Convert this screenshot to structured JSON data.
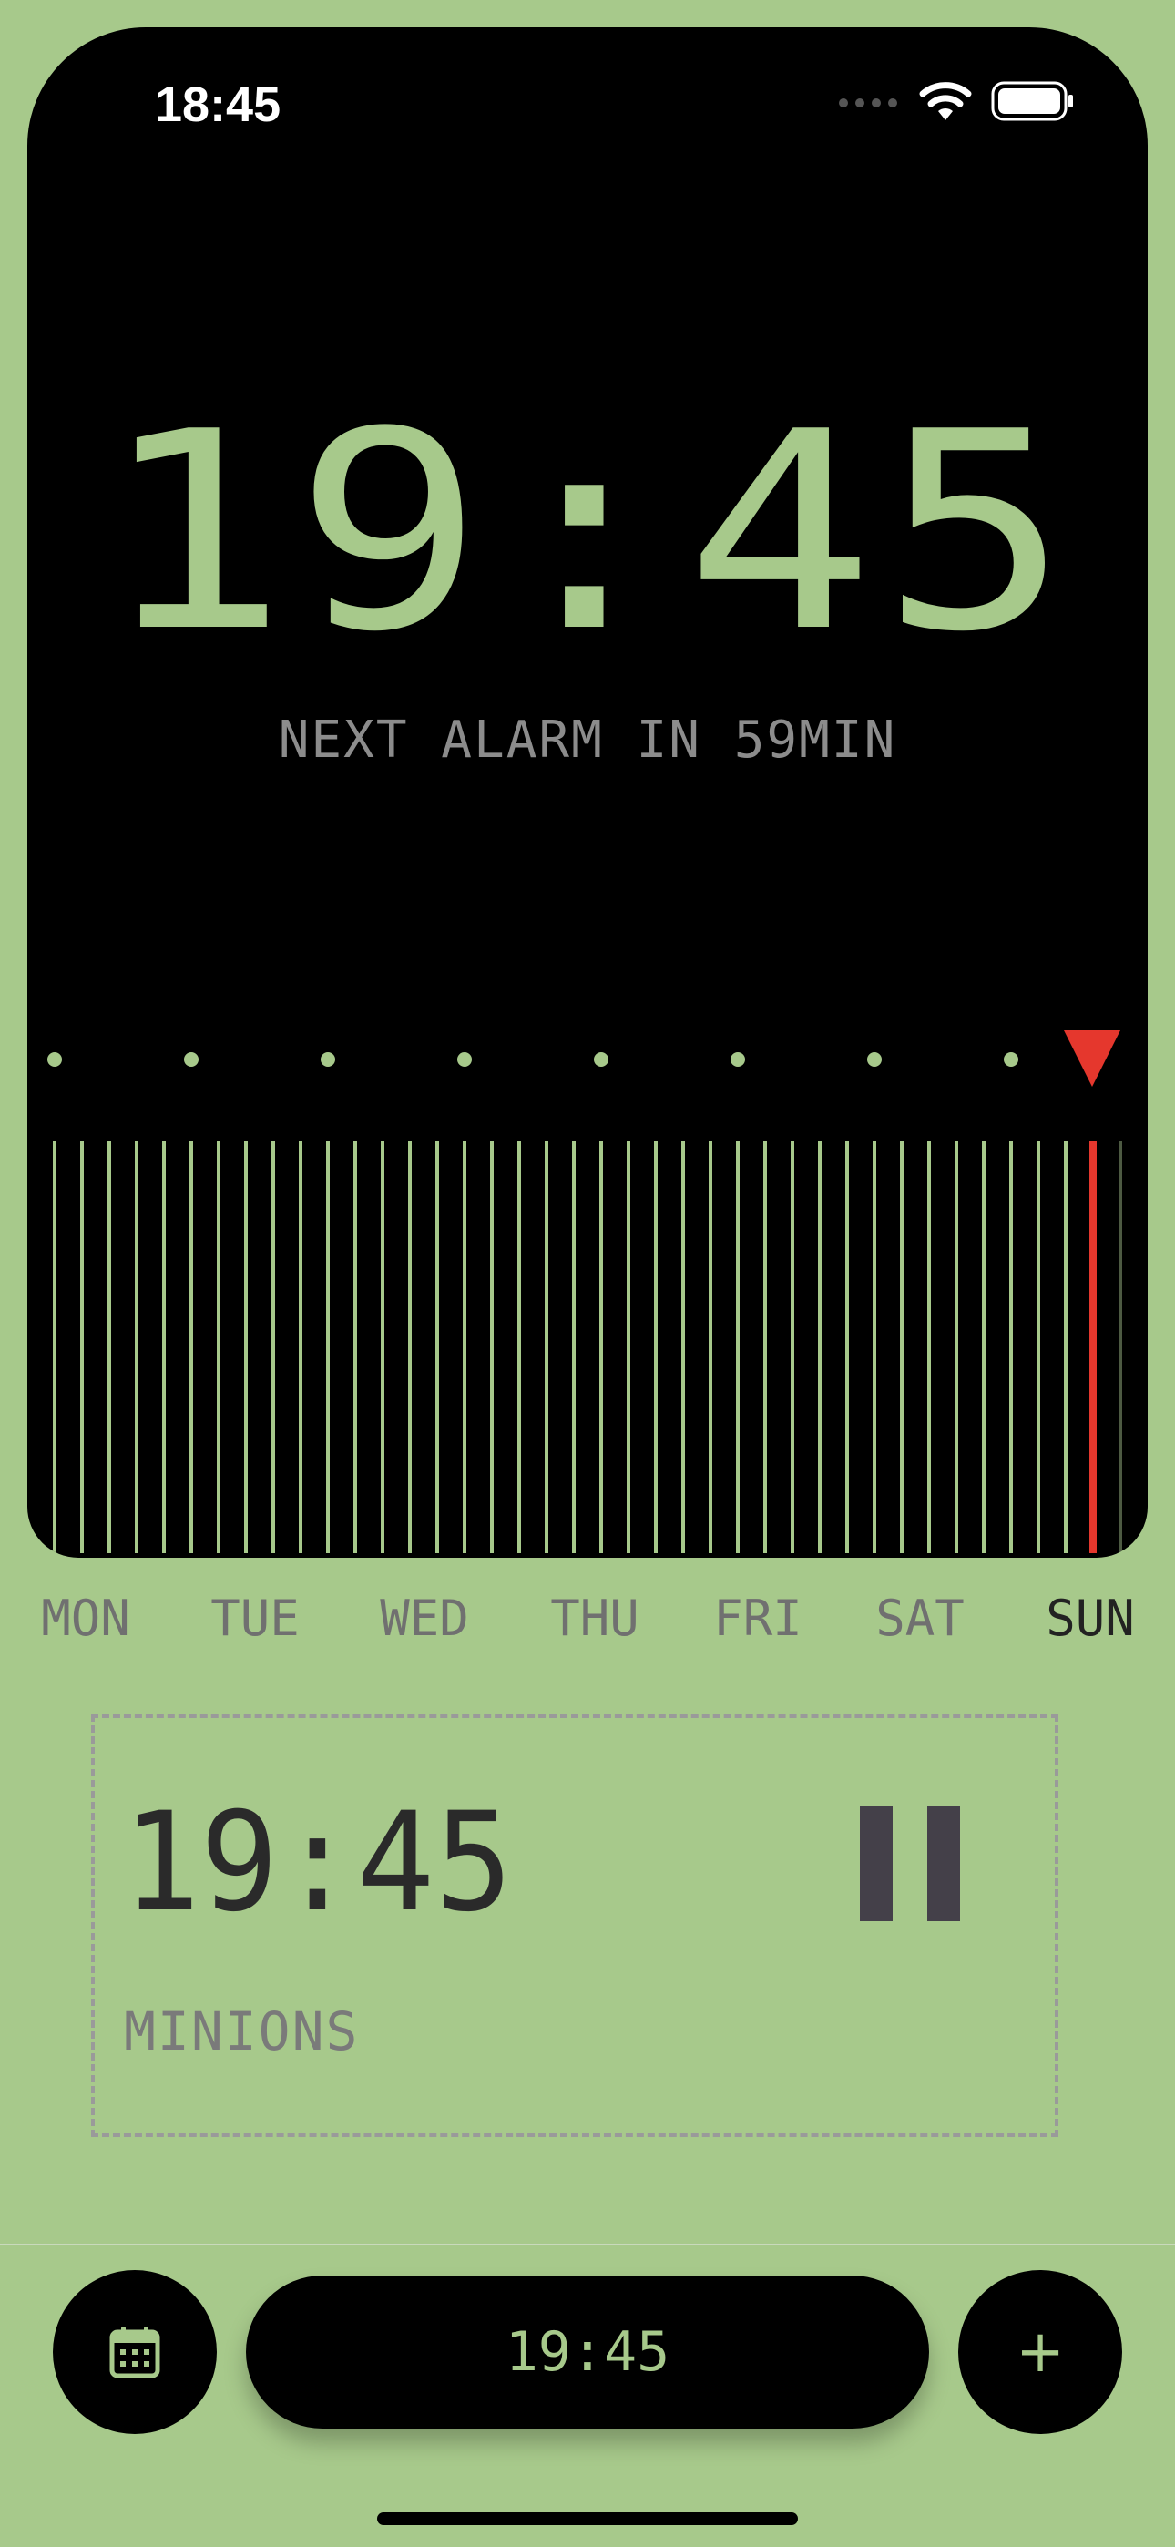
{
  "status_bar": {
    "time": "18:45"
  },
  "clock": {
    "time": "19:45",
    "next_alarm": "NEXT ALARM IN 59MIN"
  },
  "timeline": {
    "accent_color": "#a7c98b",
    "marker_color": "#e5372d"
  },
  "days": [
    {
      "label": "MON",
      "active": false
    },
    {
      "label": "TUE",
      "active": false
    },
    {
      "label": "WED",
      "active": false
    },
    {
      "label": "THU",
      "active": false
    },
    {
      "label": "FRI",
      "active": false
    },
    {
      "label": "SAT",
      "active": false
    },
    {
      "label": "SUN",
      "active": true
    }
  ],
  "alarm": {
    "time": "19:45",
    "label": "MINIONS",
    "state_icon": "pause-icon"
  },
  "bottom_bar": {
    "calendar_icon": "calendar-icon",
    "time": "19:45",
    "add_icon": "+"
  }
}
